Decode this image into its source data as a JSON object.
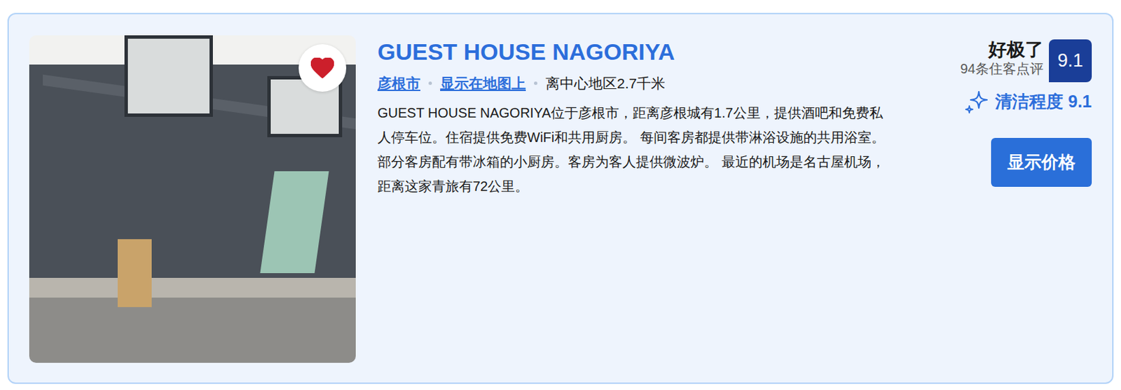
{
  "hotel": {
    "name": "GUEST HOUSE NAGORIYA",
    "favorite": true,
    "location": {
      "city": "彦根市",
      "map_link": "显示在地图上",
      "distance": "离中心地区2.7千米"
    },
    "description": "GUEST HOUSE NAGORIYA位于彦根市，距离彦根城有1.7公里，提供酒吧和免费私人停车位。住宿提供免费WiFi和共用厨房。 每间客房都提供带淋浴设施的共用浴室。部分客房配有带冰箱的小厨房。客房为客人提供微波炉。 最近的机场是名古屋机场，距离这家青旅有72公里。",
    "rating": {
      "label": "好极了",
      "reviews": "94条住客点评",
      "score": "9.1"
    },
    "cleanliness": "清洁程度 9.1",
    "button": "显示价格"
  }
}
